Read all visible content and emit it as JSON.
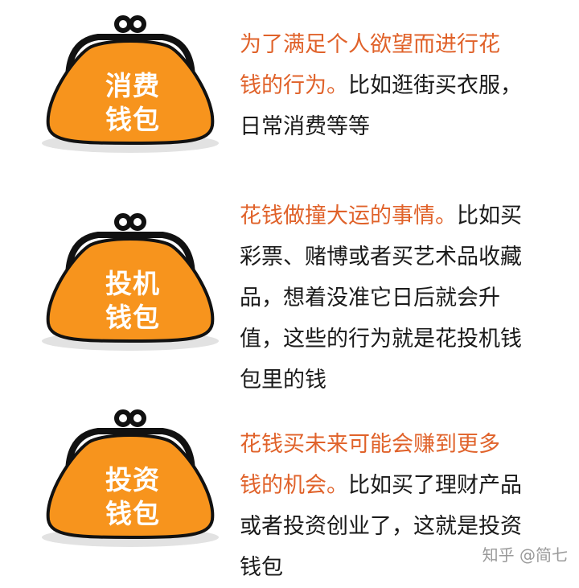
{
  "wallets": [
    {
      "name": "消费\n钱包",
      "highlight": "为了满足个人欲望而进行花钱的行为。",
      "detail": "比如逛街买衣服，日常消费等等",
      "lines": [
        [
          {
            "t": "为了满足个人欲望而进行花",
            "h": true
          }
        ],
        [
          {
            "t": "钱的行为。",
            "h": true
          },
          {
            "t": "比如逛街买衣服，",
            "h": false
          }
        ],
        [
          {
            "t": "日常消费等等",
            "h": false
          }
        ]
      ]
    },
    {
      "name": "投机\n钱包",
      "highlight": "花钱做撞大运的事情。",
      "detail": "比如买彩票、赌博或者买艺术品收藏品，想着没准它日后就会升值，这些的行为就是花投机钱包里的钱",
      "lines": [
        [
          {
            "t": "花钱做撞大运的事情。",
            "h": true
          },
          {
            "t": "比如买",
            "h": false
          }
        ],
        [
          {
            "t": "彩票、赌博或者买艺术品收藏",
            "h": false
          }
        ],
        [
          {
            "t": "品，想着没准它日后就会升",
            "h": false
          }
        ],
        [
          {
            "t": "值，这些的行为就是花投机钱",
            "h": false
          }
        ],
        [
          {
            "t": "包里的钱",
            "h": false
          }
        ]
      ]
    },
    {
      "name": "投资\n钱包",
      "highlight": "花钱买未来可能会赚到更多钱的机会。",
      "detail": "比如买了理财产品或者投资创业了，这就是投资钱包",
      "lines": [
        [
          {
            "t": "花钱买未来可能会赚到更多",
            "h": true
          }
        ],
        [
          {
            "t": "钱的机会。",
            "h": true
          },
          {
            "t": "比如买了理财产品",
            "h": false
          }
        ],
        [
          {
            "t": "或者投资创业了，这就是投资",
            "h": false
          }
        ],
        [
          {
            "t": "钱包",
            "h": false
          }
        ]
      ]
    }
  ],
  "watermark": "知乎 @简七",
  "colors": {
    "purse_fill": "#f7941d",
    "highlight": "#e0622a",
    "outline": "#111111",
    "shadow": "#e2e2e2"
  },
  "icons": [
    "coin-purse-icon",
    "coin-purse-icon",
    "coin-purse-icon"
  ]
}
